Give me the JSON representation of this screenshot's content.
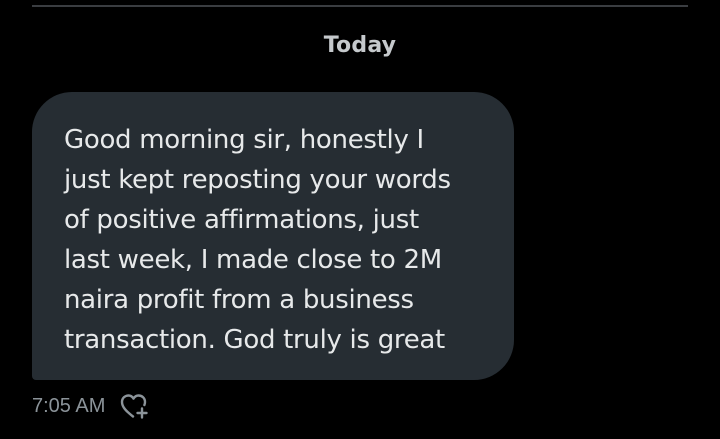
{
  "conversation": {
    "date_separator": "Today",
    "message": {
      "lines": [
        "Good morning sir, honestly I",
        "just kept reposting your words",
        "of positive affirmations, just",
        "last week, I made close to 2M",
        "naira profit from a business",
        "transaction. God truly is great"
      ],
      "timestamp": "7:05 AM",
      "reaction_icon": "heart-plus-icon"
    }
  },
  "colors": {
    "background": "#000000",
    "bubble": "#262d33",
    "text": "#e7e9ea",
    "muted_text": "#8b9399",
    "divider": "#3a3d41"
  }
}
